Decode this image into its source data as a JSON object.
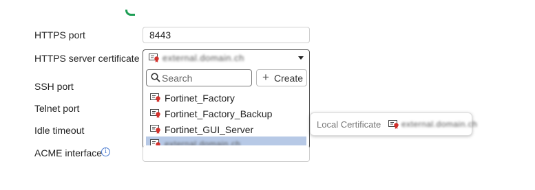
{
  "form": {
    "https_port_label": "HTTPS port",
    "https_port_value": "8443",
    "https_cert_label": "HTTPS server certificate",
    "https_cert_value": "external.domain.ch",
    "ssh_port_label": "SSH port",
    "telnet_port_label": "Telnet port",
    "idle_timeout_label": "Idle timeout",
    "acme_interface_label": "ACME interface",
    "acme_info_icon": "info-icon"
  },
  "dropdown": {
    "search_placeholder": "Search",
    "search_icon": "search-icon",
    "create_label": "Create",
    "create_icon": "plus-icon",
    "options": [
      {
        "label": "Fortinet_Factory",
        "selected": false
      },
      {
        "label": "Fortinet_Factory_Backup",
        "selected": false
      },
      {
        "label": "Fortinet_GUI_Server",
        "selected": false
      },
      {
        "label": "external.domain.ch",
        "selected": true
      }
    ],
    "option_icon": "certificate-icon",
    "selected_color": "#b7c9e6"
  },
  "tooltip": {
    "label": "Local Certificate",
    "value": "external.domain.ch"
  },
  "colors": {
    "accent_green": "#1e9e55",
    "cert_icon_red": "#d3312c",
    "info_blue": "#4a7bd0"
  }
}
